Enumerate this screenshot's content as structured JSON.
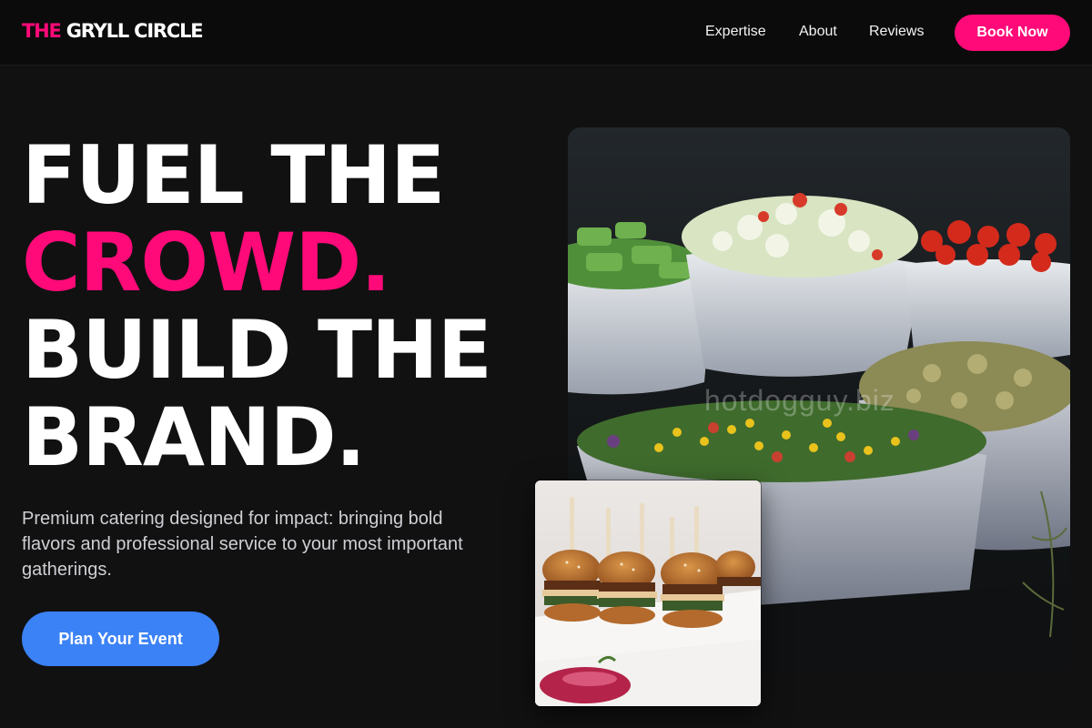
{
  "brand": {
    "accent": "THE",
    "rest": " GRYLL CIRCLE"
  },
  "nav": {
    "items": [
      "Expertise",
      "About",
      "Reviews"
    ],
    "cta": "Book Now"
  },
  "hero": {
    "line1": "FUEL THE",
    "line2": "CROWD.",
    "line3": "BUILD THE",
    "line4": "BRAND.",
    "description": "Premium catering designed for impact: bringing bold flavors and professional service to your most important gatherings.",
    "cta": "Plan Your Event"
  },
  "images": {
    "main_watermark": "hotdogguy.biz"
  },
  "colors": {
    "accent_pink": "#ff0a78",
    "cta_blue": "#3b82f6",
    "background": "#111112"
  }
}
